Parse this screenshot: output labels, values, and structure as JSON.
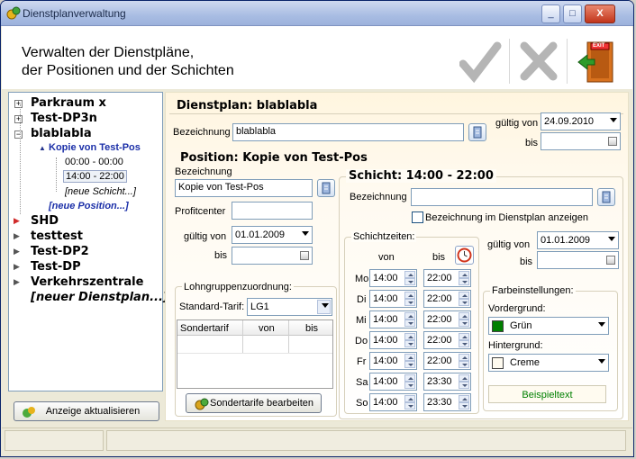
{
  "window": {
    "title": "Dienstplanverwaltung",
    "minimize": "_",
    "maximize": "□",
    "close": "X"
  },
  "header": {
    "line1": "Verwalten der Dienstpläne,",
    "line2": "der Positionen und der Schichten"
  },
  "toolbar": {
    "accept_icon": "checkmark-icon",
    "cancel_icon": "x-icon",
    "exit_icon": "exit-door-icon",
    "exit_text": "EXIT"
  },
  "tree": {
    "items": [
      {
        "label": "Parkraum x",
        "expander": "+"
      },
      {
        "label": "Test-DP3n",
        "expander": "+"
      },
      {
        "label": "blablabla",
        "expander": "−"
      },
      {
        "label": "Kopie von Test-Pos"
      },
      {
        "label": "00:00 - 00:00"
      },
      {
        "label": "14:00 - 22:00"
      },
      {
        "label": "[neue Schicht...]"
      },
      {
        "label": "[neue Position...]"
      },
      {
        "label": "SHD"
      },
      {
        "label": "testtest"
      },
      {
        "label": "Test-DP2"
      },
      {
        "label": "Test-DP"
      },
      {
        "label": "Verkehrszentrale"
      },
      {
        "label": "[neuer Dienstplan...]"
      }
    ],
    "refresh_button": "Anzeige aktualisieren"
  },
  "dienstplan": {
    "header": "Dienstplan: blablabla",
    "bezeichnung_label": "Bezeichnung",
    "bezeichnung_value": "blablabla",
    "gueltig_von_label": "gültig von",
    "gueltig_von_value": "24.09.2010",
    "bis_label": "bis",
    "bis_value": ""
  },
  "position": {
    "header": "Position: Kopie von Test-Pos",
    "bezeichnung_label": "Bezeichnung",
    "bezeichnung_value": "Kopie von Test-Pos",
    "profitcenter_label": "Profitcenter",
    "profitcenter_value": "",
    "gueltig_von_label": "gültig von",
    "gueltig_von_value": "01.01.2009",
    "bis_label": "bis",
    "bis_value": "",
    "lohngruppe_legend": "Lohngruppenzuordnung:",
    "standard_tarif_label": "Standard-Tarif:",
    "standard_tarif_value": "LG1",
    "table_headers": [
      "Sondertarif",
      "von",
      "bis"
    ],
    "sondertarife_button": "Sondertarife bearbeiten"
  },
  "schicht": {
    "header": "Schicht: 14:00 - 22:00",
    "bezeichnung_label": "Bezeichnung",
    "bezeichnung_value": "",
    "anzeigen_label": "Bezeichnung im Dienstplan anzeigen",
    "anzeigen_checked": false,
    "schichtzeiten_legend": "Schichtzeiten:",
    "von_header": "von",
    "bis_header": "bis",
    "days": [
      {
        "day": "Mo",
        "von": "14:00",
        "bis": "22:00"
      },
      {
        "day": "Di",
        "von": "14:00",
        "bis": "22:00"
      },
      {
        "day": "Mi",
        "von": "14:00",
        "bis": "22:00"
      },
      {
        "day": "Do",
        "von": "14:00",
        "bis": "22:00"
      },
      {
        "day": "Fr",
        "von": "14:00",
        "bis": "22:00"
      },
      {
        "day": "Sa",
        "von": "14:00",
        "bis": "23:30"
      },
      {
        "day": "So",
        "von": "14:00",
        "bis": "23:30"
      }
    ],
    "gueltig_von_label": "gültig von",
    "gueltig_von_value": "01.01.2009",
    "bis_label": "bis",
    "bis_value": "",
    "farb_legend": "Farbeinstellungen:",
    "vordergrund_label": "Vordergrund:",
    "vordergrund_value": "Grün",
    "vordergrund_color": "#008000",
    "hintergrund_label": "Hintergrund:",
    "hintergrund_value": "Creme",
    "hintergrund_color": "#fffbf0",
    "beispiel_text": "Beispieltext",
    "beispiel_color": "#008000"
  }
}
